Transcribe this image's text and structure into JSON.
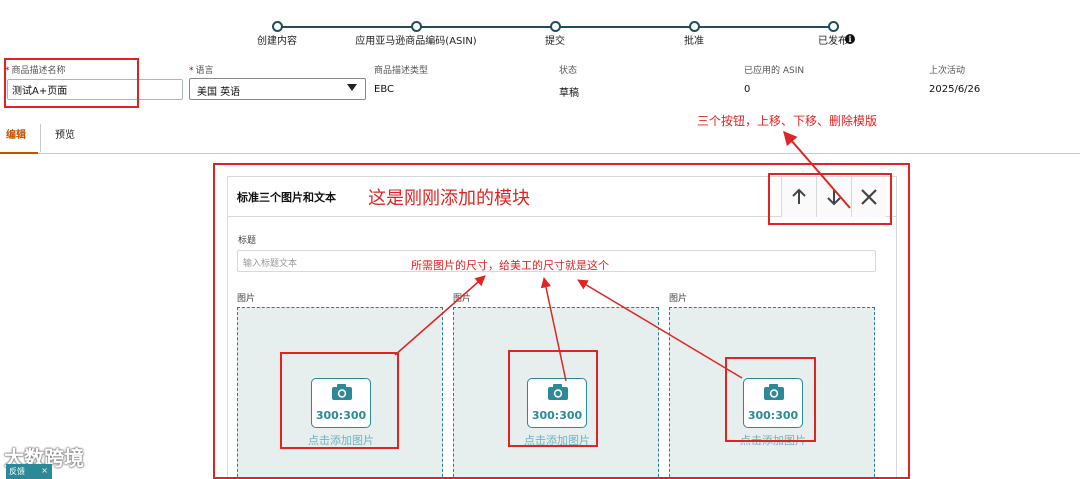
{
  "stepper": {
    "steps": [
      {
        "label": "创建内容"
      },
      {
        "label": "应用亚马逊商品编码(ASIN)"
      },
      {
        "label": "提交"
      },
      {
        "label": "批准"
      },
      {
        "label": "已发布"
      }
    ]
  },
  "info": {
    "name_label": "商品描述名称",
    "name_value": "测试A+页面",
    "language_label": "语言",
    "language_value": "美国 英语",
    "type_label": "商品描述类型",
    "type_value": "EBC",
    "status_label": "状态",
    "status_value": "草稿",
    "asin_label": "已应用的 ASIN",
    "asin_value": "0",
    "activity_label": "上次活动",
    "activity_value": "2025/6/26",
    "required_mark": "*"
  },
  "tabs": [
    {
      "label": "编辑",
      "active": true
    },
    {
      "label": "预览",
      "active": false
    }
  ],
  "module": {
    "title": "标准三个图片和文本",
    "heading_label": "标题",
    "heading_placeholder": "输入标题文本",
    "images": [
      {
        "label": "图片",
        "size": "300:300",
        "add_text": "点击添加图片"
      },
      {
        "label": "图片",
        "size": "300:300",
        "add_text": "点击添加图片"
      },
      {
        "label": "图片",
        "size": "300:300",
        "add_text": "点击添加图片"
      }
    ],
    "icons": {
      "up": "arrow-up-icon",
      "down": "arrow-down-icon",
      "delete": "close-icon",
      "image": "camera-icon"
    }
  },
  "annotations": {
    "new_module": "这是刚刚添加的模块",
    "buttons": "三个按钮，上移、下移、删除模版",
    "image_size": "所需图片的尺寸，给美工的尺寸就是这个"
  },
  "watermark": "大数跨境",
  "feedback": {
    "label": "反馈",
    "close": "×"
  },
  "colors": {
    "accent": "#c45500",
    "teal": "#2a8a98",
    "annotation_red": "#e02424",
    "stepper_line": "#1f4e5a"
  }
}
